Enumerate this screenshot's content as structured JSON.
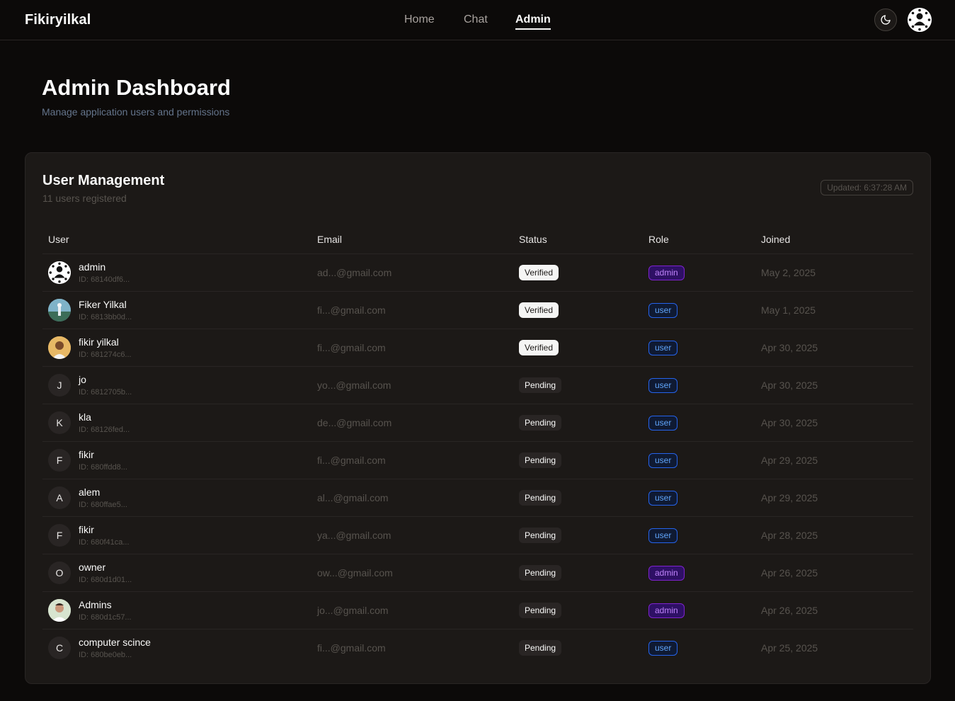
{
  "nav": {
    "brand": "Fikiryilkal",
    "links": [
      {
        "label": "Home",
        "active": false
      },
      {
        "label": "Chat",
        "active": false
      },
      {
        "label": "Admin",
        "active": true
      }
    ]
  },
  "header": {
    "title": "Admin Dashboard",
    "subtitle": "Manage application users and permissions"
  },
  "card": {
    "title": "User Management",
    "subtitle": "11 users registered",
    "updated": "Updated: 6:37:28 AM"
  },
  "table": {
    "columns": [
      "User",
      "Email",
      "Status",
      "Role",
      "Joined"
    ],
    "rows": [
      {
        "name": "admin",
        "id": "ID: 68140df6...",
        "avatar": "",
        "avatar_type": "img-admin",
        "email": "ad...@gmail.com",
        "status": "Verified",
        "role": "admin",
        "joined": "May 2, 2025"
      },
      {
        "name": "Fiker Yilkal",
        "id": "ID: 6813bb0d...",
        "avatar": "",
        "avatar_type": "img-fiker",
        "email": "fi...@gmail.com",
        "status": "Verified",
        "role": "user",
        "joined": "May 1, 2025"
      },
      {
        "name": "fikir yilkal",
        "id": "ID: 681274c6...",
        "avatar": "",
        "avatar_type": "img-fikir",
        "email": "fi...@gmail.com",
        "status": "Verified",
        "role": "user",
        "joined": "Apr 30, 2025"
      },
      {
        "name": "jo",
        "id": "ID: 6812705b...",
        "avatar": "J",
        "avatar_type": "initial",
        "email": "yo...@gmail.com",
        "status": "Pending",
        "role": "user",
        "joined": "Apr 30, 2025"
      },
      {
        "name": "kla",
        "id": "ID: 68126fed...",
        "avatar": "K",
        "avatar_type": "initial",
        "email": "de...@gmail.com",
        "status": "Pending",
        "role": "user",
        "joined": "Apr 30, 2025"
      },
      {
        "name": "fikir",
        "id": "ID: 680ffdd8...",
        "avatar": "F",
        "avatar_type": "initial",
        "email": "fi...@gmail.com",
        "status": "Pending",
        "role": "user",
        "joined": "Apr 29, 2025"
      },
      {
        "name": "alem",
        "id": "ID: 680ffae5...",
        "avatar": "A",
        "avatar_type": "initial",
        "email": "al...@gmail.com",
        "status": "Pending",
        "role": "user",
        "joined": "Apr 29, 2025"
      },
      {
        "name": "fikir",
        "id": "ID: 680f41ca...",
        "avatar": "F",
        "avatar_type": "initial",
        "email": "ya...@gmail.com",
        "status": "Pending",
        "role": "user",
        "joined": "Apr 28, 2025"
      },
      {
        "name": "owner",
        "id": "ID: 680d1d01...",
        "avatar": "O",
        "avatar_type": "initial",
        "email": "ow...@gmail.com",
        "status": "Pending",
        "role": "admin",
        "joined": "Apr 26, 2025"
      },
      {
        "name": "Admins",
        "id": "ID: 680d1c57...",
        "avatar": "",
        "avatar_type": "img-admins",
        "email": "jo...@gmail.com",
        "status": "Pending",
        "role": "admin",
        "joined": "Apr 26, 2025"
      },
      {
        "name": "computer scince",
        "id": "ID: 680be0eb...",
        "avatar": "C",
        "avatar_type": "initial",
        "email": "fi...@gmail.com",
        "status": "Pending",
        "role": "user",
        "joined": "Apr 25, 2025"
      }
    ]
  },
  "icons": {
    "theme_toggle": "moon-icon",
    "user_avatar": "avatar-icon"
  }
}
